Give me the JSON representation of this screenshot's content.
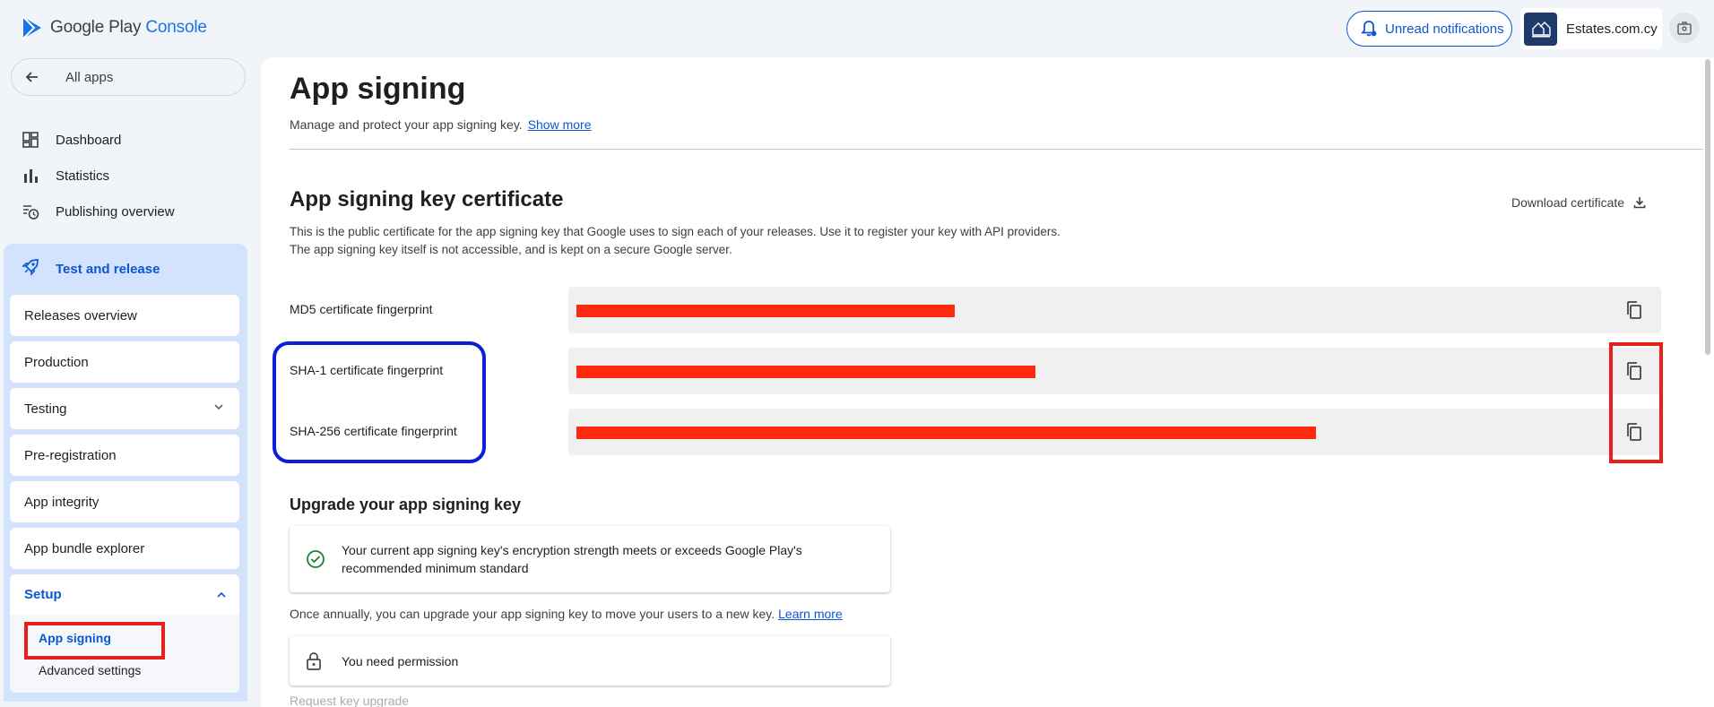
{
  "header": {
    "app_brand": "Google Play",
    "app_brand_suffix": "Console",
    "notifications_label": "Unread notifications",
    "account_name": "Estates.com.cy",
    "account_logo_text": "Estates.com.cy"
  },
  "sidebar": {
    "back_label": "All apps",
    "top_items": [
      {
        "label": "Dashboard",
        "icon": "dashboard-icon"
      },
      {
        "label": "Statistics",
        "icon": "bar-chart-icon"
      },
      {
        "label": "Publishing overview",
        "icon": "publishing-history-icon"
      }
    ],
    "group_label": "Test and release",
    "group_items": [
      {
        "label": "Releases overview"
      },
      {
        "label": "Production"
      },
      {
        "label": "Testing"
      },
      {
        "label": "Pre-registration"
      },
      {
        "label": "App integrity"
      },
      {
        "label": "App bundle explorer"
      }
    ],
    "setup": {
      "label": "Setup",
      "items": [
        {
          "label": "App signing",
          "selected": true
        },
        {
          "label": "Advanced settings",
          "selected": false
        }
      ]
    }
  },
  "main": {
    "title": "App signing",
    "subtitle": "Manage and protect your app signing key.",
    "show_more": "Show more",
    "certificate": {
      "title": "App signing key certificate",
      "download_label": "Download certificate",
      "description": "This is the public certificate for the app signing key that Google uses to sign each of your releases. Use it to register your key with API providers. The app signing key itself is not accessible, and is kept on a secure Google server.",
      "fingerprints": [
        {
          "label": "MD5 certificate fingerprint"
        },
        {
          "label": "SHA-1 certificate fingerprint"
        },
        {
          "label": "SHA-256 certificate fingerprint"
        }
      ]
    },
    "upgrade": {
      "title": "Upgrade your app signing key",
      "status_text": "Your current app signing key's encryption strength meets or exceeds Google Play's recommended minimum standard",
      "annual_text": "Once annually, you can upgrade your app signing key to move your users to a new key.",
      "learn_more": "Learn more",
      "permission_text": "You need permission",
      "request_label": "Request key upgrade"
    }
  },
  "colors": {
    "accent": "#0b57d0",
    "nav_group_bg": "#d3e3fd",
    "annotation_red": "#e8201a",
    "annotation_blue": "#0b1fd8",
    "redaction": "#fe2a10",
    "success_green": "#188038"
  }
}
